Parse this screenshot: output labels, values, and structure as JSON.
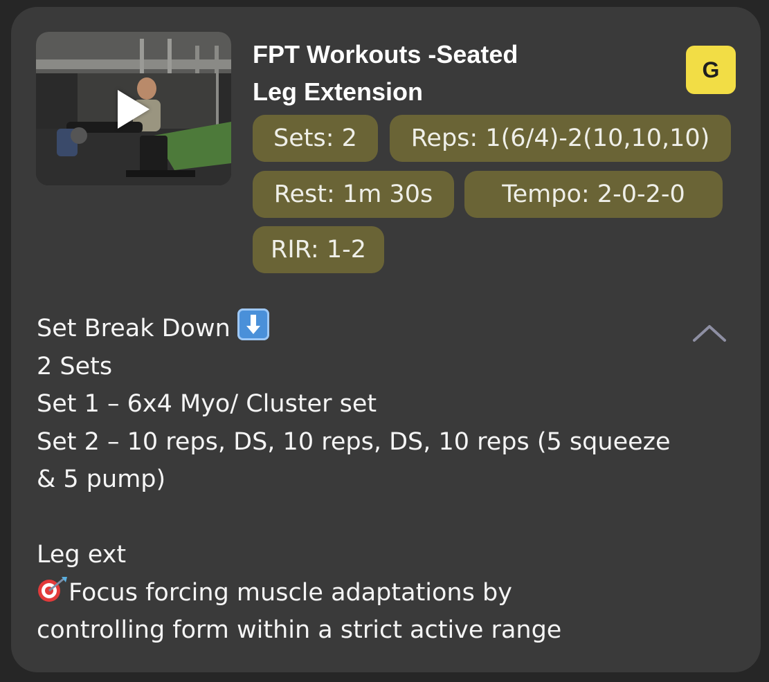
{
  "card": {
    "title_line1": "FPT Workouts -Seated",
    "title_line2": "Leg Extension",
    "badge_letter": "G",
    "video_icon": "play-icon",
    "chips": {
      "sets": "Sets: 2",
      "reps": "Reps: 1(6/4)-2(10,10,10)",
      "rest": "Rest: 1m 30s",
      "tempo": "Tempo: 2-0-2-0",
      "rir": "RIR: 1-2"
    },
    "description": {
      "heading": "Set Break Down",
      "heading_icon": "down-arrow-emoji-icon",
      "line_sets": "2 Sets",
      "line_set1": "Set 1 – 6x4  Myo/ Cluster set",
      "line_set2a": "Set 2 – 10 reps, DS, 10 reps, DS, 10 reps (5 squeeze",
      "line_set2b": "& 5 pump)",
      "line_exercise": "Leg ext",
      "focus_icon": "target-emoji-icon",
      "line_focus": "Focus  forcing muscle adaptations by",
      "line_focus2": "controlling form within a strict active range"
    },
    "collapse_icon": "chevron-up-icon"
  },
  "colors": {
    "background": "#262626",
    "card": "#3a3a3a",
    "chip": "#6a6436",
    "badge": "#f2dd45"
  }
}
